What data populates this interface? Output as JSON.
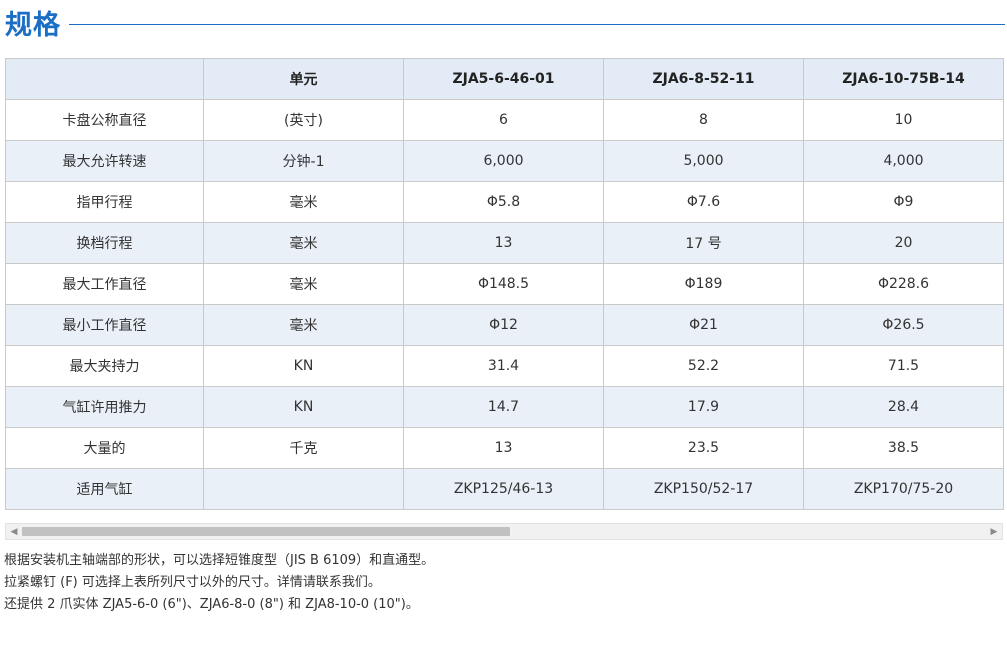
{
  "heading": {
    "title": "规格"
  },
  "table": {
    "headers": [
      "",
      "单元",
      "ZJA5-6-46-01",
      "ZJA6-8-52-11",
      "ZJA6-10-75B-14"
    ],
    "rows": [
      [
        "卡盘公称直径",
        "(英寸)",
        "6",
        "8",
        "10"
      ],
      [
        "最大允许转速",
        "分钟-1",
        "6,000",
        "5,000",
        "4,000"
      ],
      [
        "指甲行程",
        "毫米",
        "Φ5.8",
        "Φ7.6",
        "Φ9"
      ],
      [
        "换档行程",
        "毫米",
        "13",
        "17 号",
        "20"
      ],
      [
        "最大工作直径",
        "毫米",
        "Φ148.5",
        "Φ189",
        "Φ228.6"
      ],
      [
        "最小工作直径",
        "毫米",
        "Φ12",
        "Φ21",
        "Φ26.5"
      ],
      [
        "最大夹持力",
        "KN",
        "31.4",
        "52.2",
        "71.5"
      ],
      [
        "气缸许用推力",
        "KN",
        "14.7",
        "17.9",
        "28.4"
      ],
      [
        "大量的",
        "千克",
        "13",
        "23.5",
        "38.5"
      ],
      [
        "适用气缸",
        "",
        "ZKP125/46-13",
        "ZKP150/52-17",
        "ZKP170/75-20"
      ]
    ]
  },
  "scrollbar": {
    "left_arrow": "◀",
    "right_arrow": "▶",
    "scroll_position_percent": 0
  },
  "notes": [
    "根据安装机主轴端部的形状，可以选择短锥度型（JIS B 6109）和直通型。",
    "拉紧螺钉 (F) 可选择上表所列尺寸以外的尺寸。详情请联系我们。",
    "还提供 2 爪实体 ZJA5-6-0 (6\")、ZJA6-8-0 (8\") 和 ZJA8-10-0 (10\")。"
  ]
}
